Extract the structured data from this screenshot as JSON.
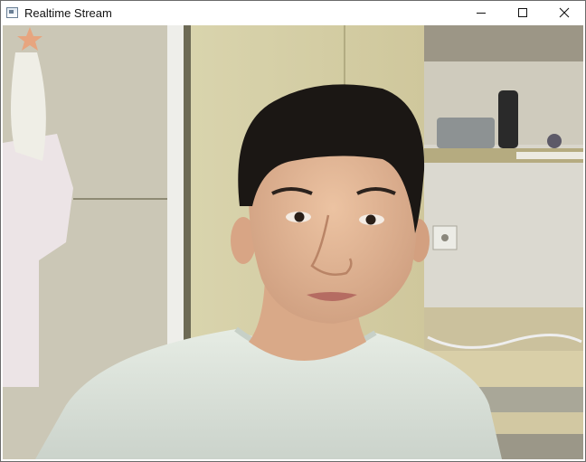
{
  "window": {
    "title": "Realtime Stream",
    "icon": "app-window-icon",
    "controls": {
      "minimize_icon": "minimize-icon",
      "maximize_icon": "maximize-icon",
      "close_icon": "close-icon"
    }
  },
  "stream": {
    "content": "webcam-feed",
    "colors": {
      "wall": "#d9d7c8",
      "cabinet": "#d6d0a8",
      "shirt": "#dce4dc",
      "skin": "#e2b493",
      "hair": "#1b1714"
    }
  }
}
